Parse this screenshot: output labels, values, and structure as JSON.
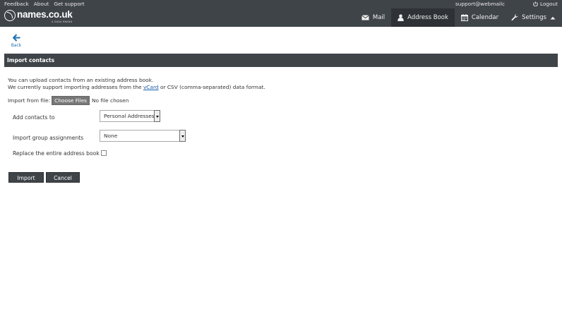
{
  "header": {
    "links": [
      "Feedback",
      "About",
      "Get support"
    ],
    "logo_text": "names.co.uk",
    "logo_sub": "A DADA BRAND",
    "user_email": "support@webmailc",
    "logout_label": "Logout",
    "nav": {
      "mail": "Mail",
      "address_book": "Address Book",
      "calendar": "Calendar",
      "settings": "Settings"
    }
  },
  "back_label": "Back",
  "section_title": "Import contacts",
  "description": {
    "line1": "You can upload contacts from an existing address book.",
    "line2_prefix": "We currently support importing addresses from the",
    "line2_link": "vCard",
    "line2_suffix": "or CSV (comma-separated) data format."
  },
  "file": {
    "label": "Import from file:",
    "button": "Choose Files",
    "status": "No file chosen"
  },
  "form": {
    "add_to_label": "Add contacts to",
    "add_to_value": "Personal Addresses",
    "groups_label": "Import group assignments",
    "groups_value": "None",
    "replace_label": "Replace the entire address book",
    "replace_checked": false
  },
  "actions": {
    "import": "Import",
    "cancel": "Cancel"
  },
  "colors": {
    "header_bg": "#3f4449",
    "active_nav_bg": "#2e3236",
    "link": "#1a5fa8"
  }
}
